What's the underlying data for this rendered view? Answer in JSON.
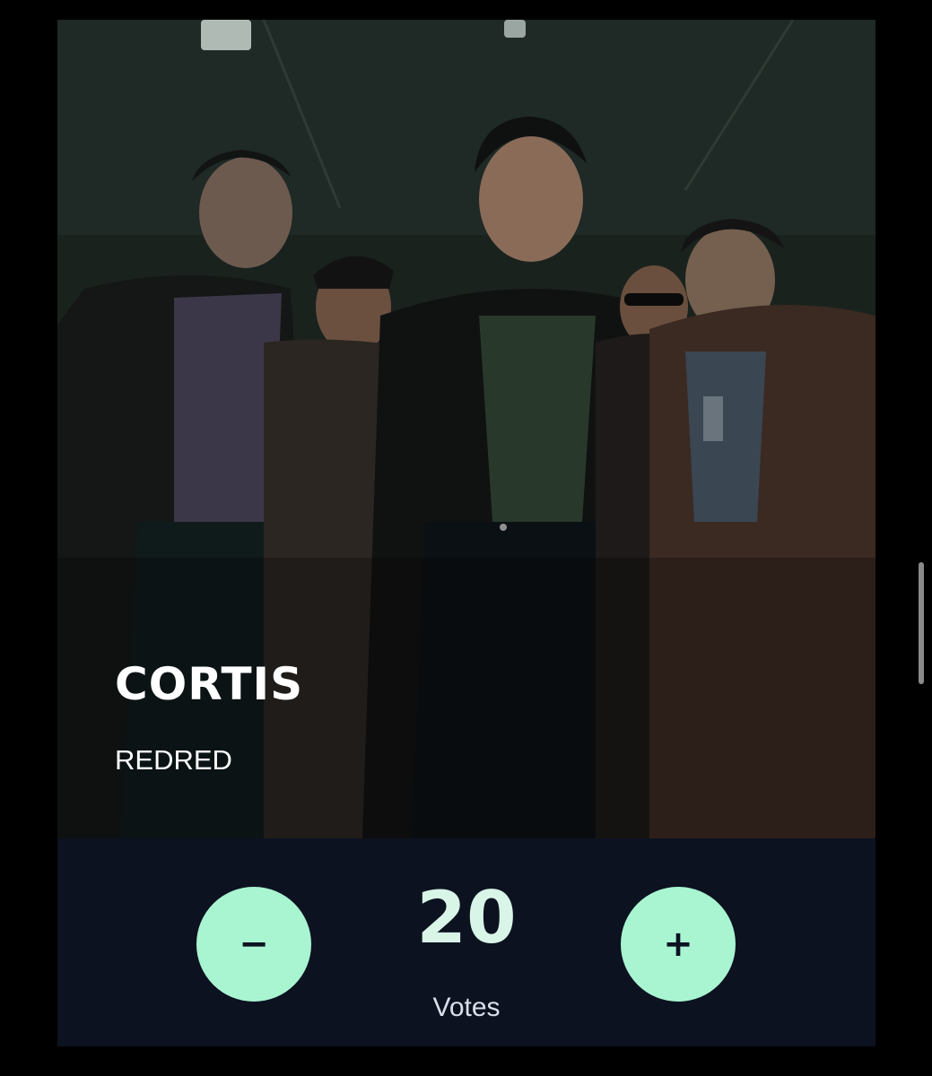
{
  "artist": {
    "name": "CORTIS",
    "song": "REDRED"
  },
  "votes": {
    "count": "20",
    "label": "Votes",
    "decrement_symbol": "−",
    "increment_symbol": "+"
  },
  "colors": {
    "button_accent": "#a9f5d2",
    "vote_panel": "#0c1220",
    "count_text": "#d8f5e8"
  },
  "icons": {
    "minus": "minus-icon",
    "plus": "plus-icon"
  }
}
